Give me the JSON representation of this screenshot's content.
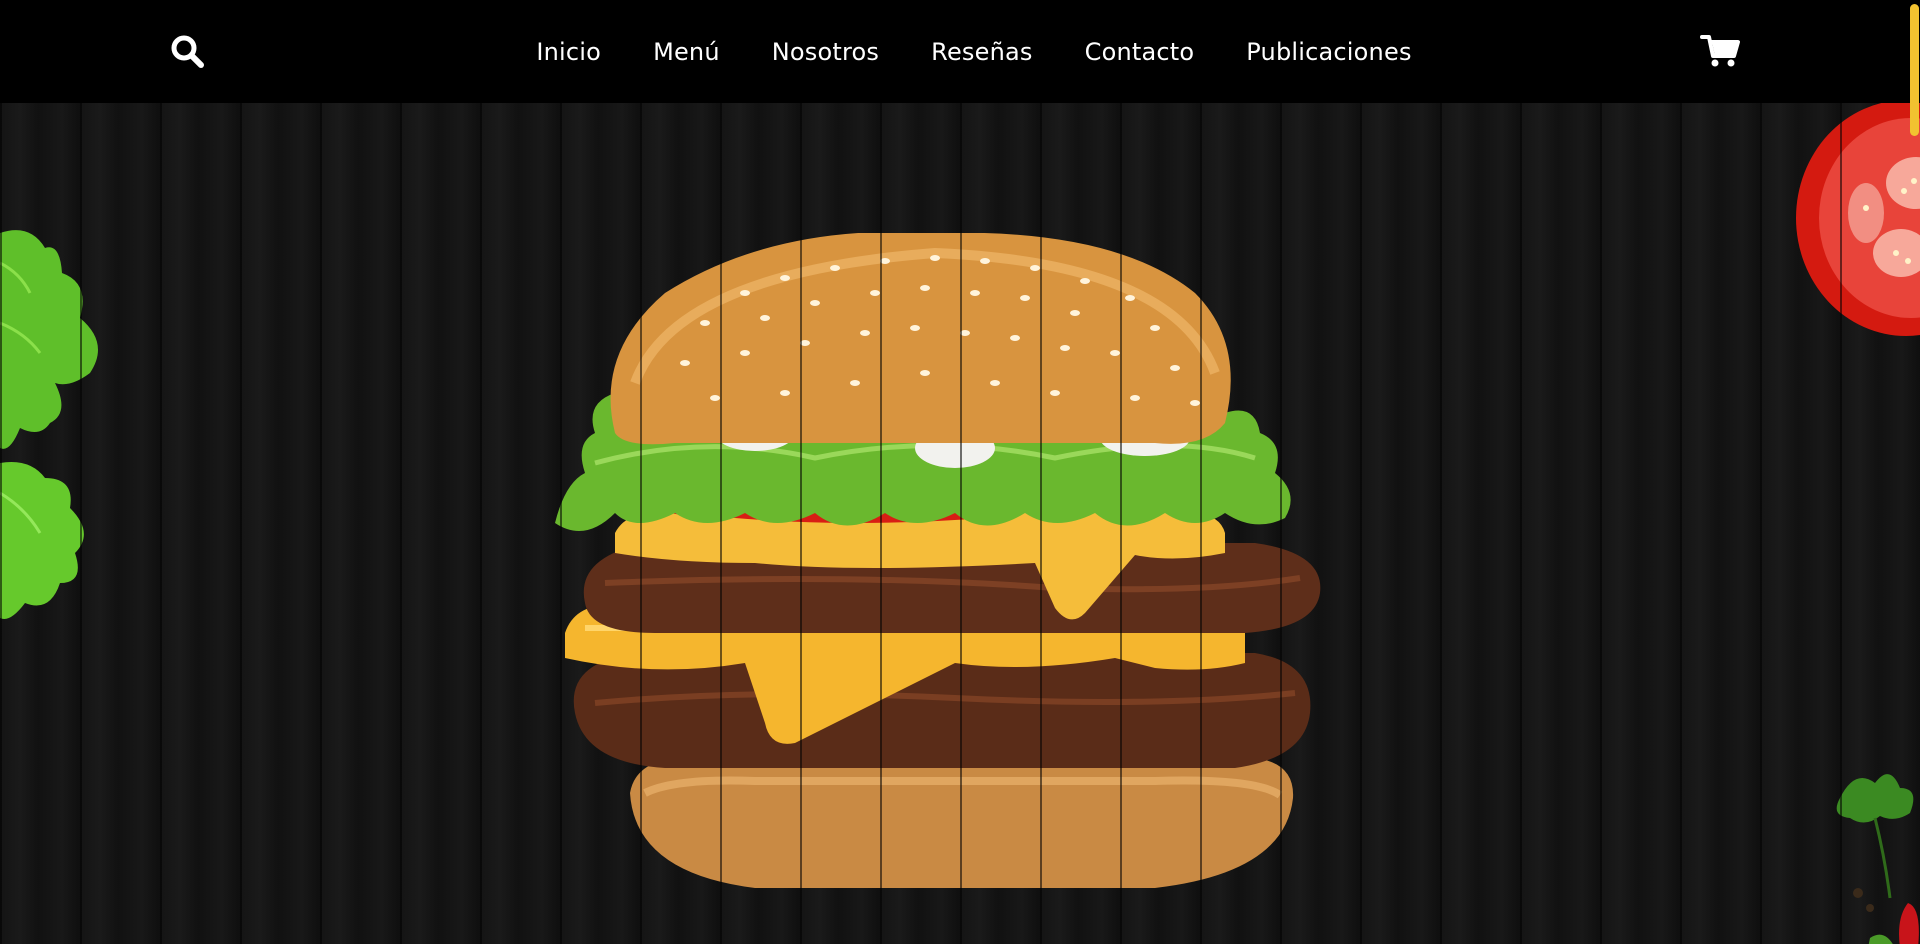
{
  "header": {
    "search_icon": "search-icon",
    "cart_icon": "shopping-cart-icon",
    "nav": [
      {
        "label": "Inicio"
      },
      {
        "label": "Menú"
      },
      {
        "label": "Nosotros"
      },
      {
        "label": "Reseñas"
      },
      {
        "label": "Contacto"
      },
      {
        "label": "Publicaciones"
      }
    ]
  },
  "hero": {
    "image": "double-cheeseburger",
    "decorations": [
      "lettuce-leaf",
      "tomato-slice",
      "parsley-sprig"
    ]
  },
  "colors": {
    "nav_background": "#000000",
    "nav_text": "#ffffff",
    "hero_background": "#141414",
    "accent": "#f2c230"
  }
}
